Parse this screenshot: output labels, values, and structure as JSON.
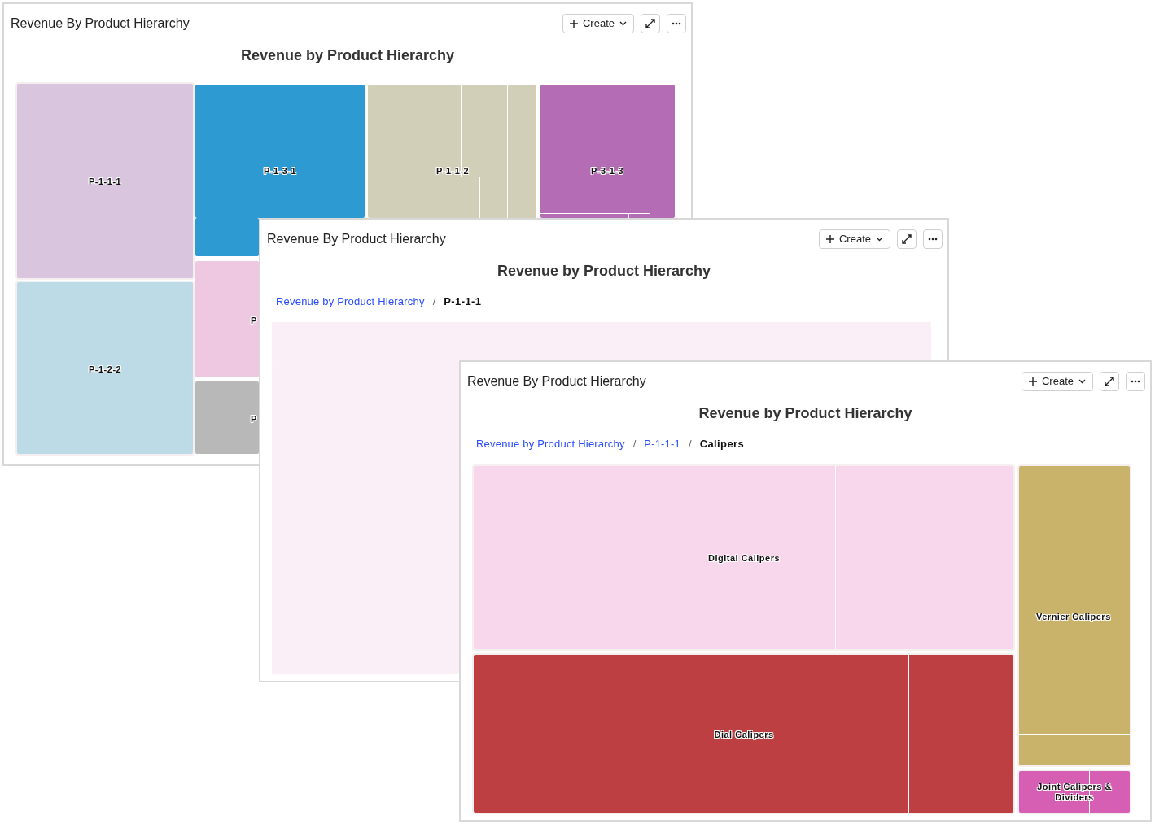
{
  "windows": [
    {
      "title": "Revenue By Product Hierarchy",
      "create_button": "Create",
      "chart_title": "Revenue by Product Hierarchy",
      "tiles": [
        {
          "label": "P-1-1-1",
          "color": "#d9c6de"
        },
        {
          "label": "P-1-2-2",
          "color": "#bddbe6"
        },
        {
          "label": "P-1-3-1",
          "color": "#2e9ad2"
        },
        {
          "label": "P",
          "color": "#eec8e0"
        },
        {
          "label": "P",
          "color": "#b8b8b8"
        },
        {
          "label": "P-1-1-2",
          "color": "#d2cfb8"
        },
        {
          "label": "P-3-1-3",
          "color": "#b46db5"
        }
      ]
    },
    {
      "title": "Revenue By Product Hierarchy",
      "create_button": "Create",
      "chart_title": "Revenue by Product Hierarchy",
      "breadcrumb": [
        {
          "label": "Revenue by Product Hierarchy",
          "current": false
        },
        {
          "separator": "/",
          "label": "P-1-1-1",
          "current": true
        }
      ],
      "tiles": [
        {
          "color": "#fbeff7"
        }
      ]
    },
    {
      "title": "Revenue By Product Hierarchy",
      "create_button": "Create",
      "chart_title": "Revenue by Product Hierarchy",
      "breadcrumb": [
        {
          "label": "Revenue by Product Hierarchy",
          "current": false
        },
        {
          "separator": "/",
          "label": "P-1-1-1",
          "current": false
        },
        {
          "separator": "/",
          "label": "Calipers",
          "current": true
        }
      ],
      "tiles": [
        {
          "label": "Digital Calipers",
          "color": "#f8d6ec"
        },
        {
          "label": "Dial Calipers",
          "color": "#be3f42"
        },
        {
          "label": "Vernier Calipers",
          "color": "#c9b26a"
        },
        {
          "label": "Joint Calipers & Dividers",
          "color": "#d75fb3"
        }
      ]
    }
  ]
}
